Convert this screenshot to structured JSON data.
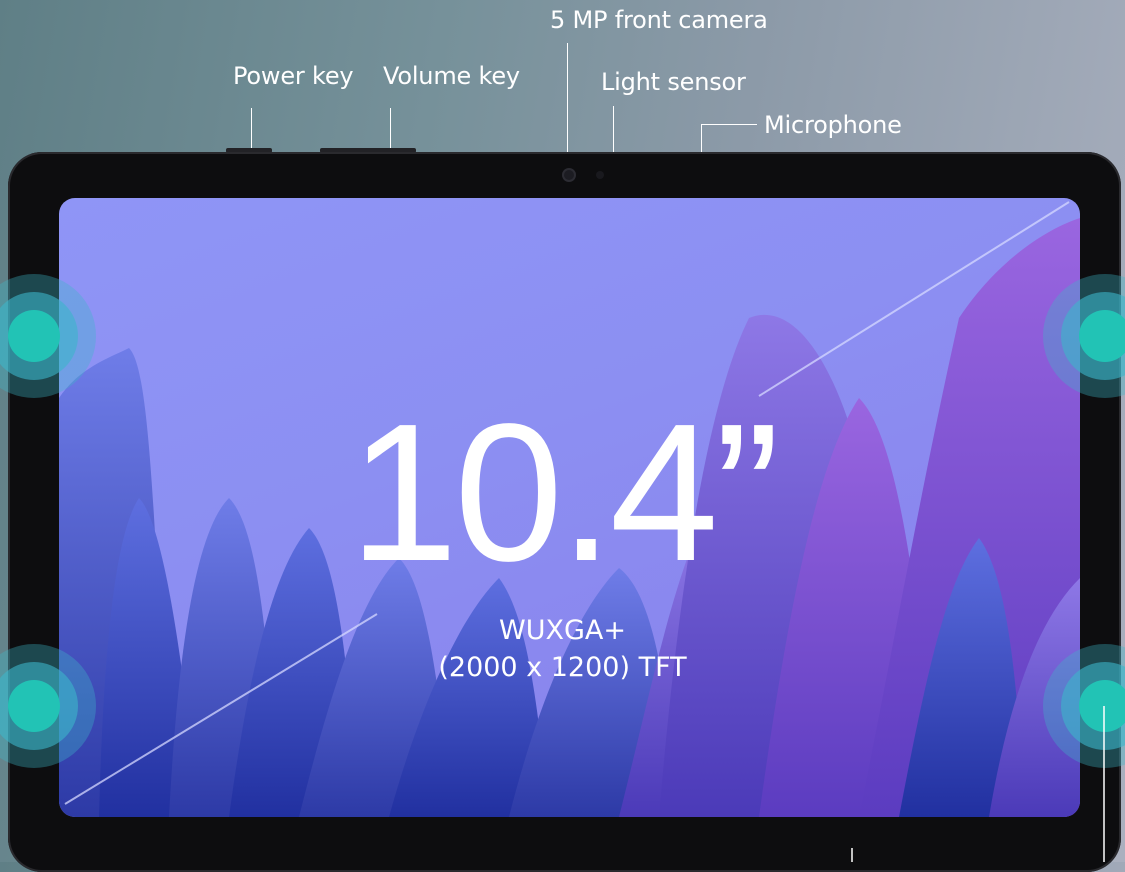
{
  "labels": {
    "front_camera": "5 MP front camera",
    "power_key": "Power key",
    "volume_key": "Volume key",
    "light_sensor": "Light sensor",
    "microphone": "Microphone"
  },
  "screen": {
    "size": "10.4”",
    "resolution_line1": "WUXGA+",
    "resolution_line2": "(2000 x 1200) TFT"
  },
  "colors": {
    "speaker_core": "#22c3b5",
    "speaker_ring": "#3cb6c9",
    "screen_tint": "#8c8ff2",
    "bezel": "#0d0d0f"
  },
  "icons": [
    "speaker-icon",
    "camera-lens-icon",
    "light-sensor-icon"
  ]
}
